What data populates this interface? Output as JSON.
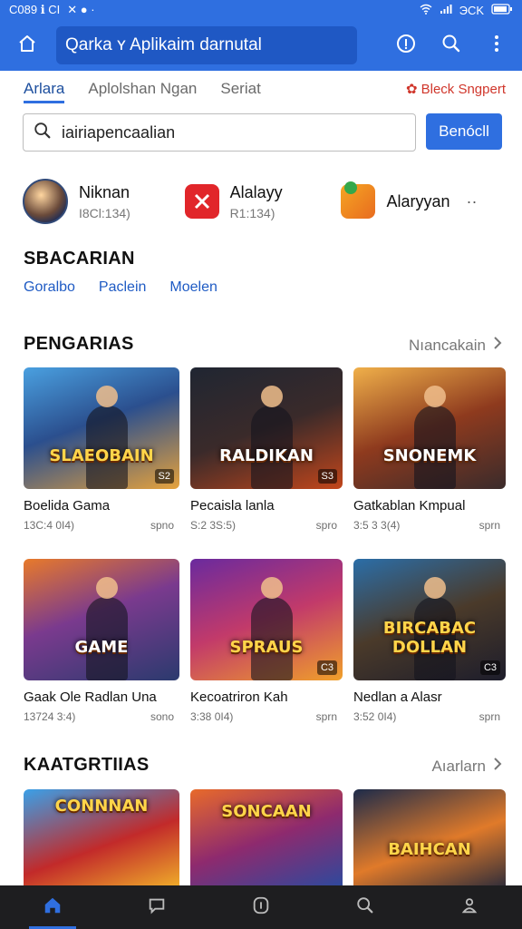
{
  "status_bar": {
    "time": "C089 ℹ CI",
    "right": "ЭCK"
  },
  "header": {
    "title": "Qarka ʏ Aplikaim darnutal"
  },
  "tabs": [
    {
      "label": "Arlara",
      "active": true
    },
    {
      "label": "Aplolshan Ngan",
      "active": false
    },
    {
      "label": "Seriat",
      "active": false
    }
  ],
  "tab_right_label": "Bleck Sngpert",
  "search": {
    "value": "iairiapencaalian",
    "button_label": "Benócll"
  },
  "apps": [
    {
      "name": "Niknan",
      "sub": "I8Cl:134)"
    },
    {
      "name": "Alalayy",
      "sub": "R1:134)"
    },
    {
      "name": "Alaryyan",
      "sub": ""
    }
  ],
  "section1": {
    "title": "SBACARIAN",
    "chips": [
      "Goralbo",
      "Paclein",
      "Moelen"
    ]
  },
  "section2": {
    "title": "PENGARIAS",
    "link": "Nıancakain",
    "cards": [
      {
        "title": "Boelida Gama",
        "meta": "13C:4 0I4)",
        "tag": "spno",
        "logo": "SLAEOBAIN",
        "badge": "S2"
      },
      {
        "title": "Pecaisla lanla",
        "meta": "S:2 3S:5)",
        "tag": "spro",
        "logo": "RALDIKAN",
        "badge": "S3"
      },
      {
        "title": "Gatkablan Kmpual",
        "meta": "3:5 3 3(4)",
        "tag": "sprn",
        "logo": "SNONEMK",
        "badge": ""
      },
      {
        "title": "Gaak Ole Radlan Una",
        "meta": "13724 3:4)",
        "tag": "sono",
        "logo": "GAME",
        "badge": ""
      },
      {
        "title": "Kecoatriron Kah",
        "meta": "3:38 0I4)",
        "tag": "sprn",
        "logo": "SPRAUS",
        "badge": "C3"
      },
      {
        "title": "Nedlan a Alasr",
        "meta": "3:52 0I4)",
        "tag": "sprn",
        "logo": "BIRCABAC DOLLAN",
        "badge": "C3"
      }
    ]
  },
  "section3": {
    "title": "KAATGRTIIAS",
    "link": "Aıarlarn",
    "cards": [
      {
        "logo": "CONNNAN"
      },
      {
        "logo": "SONCAAN"
      },
      {
        "logo": "BAIHCAN"
      }
    ]
  },
  "bottom_nav": [
    "home-icon",
    "chat-icon",
    "badge-icon",
    "search-icon",
    "profile-icon"
  ],
  "colors": {
    "primary": "#2f6fe0",
    "header_input": "#1f58c4",
    "accent_red": "#d0362b",
    "nav_bg": "#1e1e20"
  }
}
